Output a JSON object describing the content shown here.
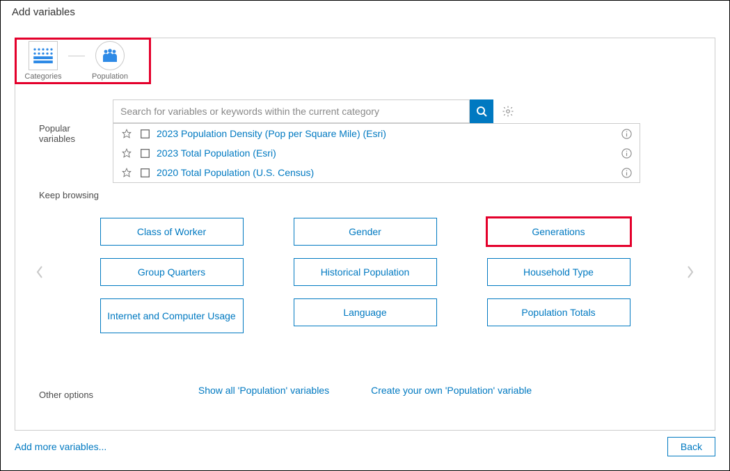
{
  "dialog": {
    "title": "Add variables"
  },
  "breadcrumb": {
    "categories_label": "Categories",
    "population_label": "Population"
  },
  "search": {
    "placeholder": "Search for variables or keywords within the current category"
  },
  "sections": {
    "popular": "Popular variables",
    "keep": "Keep browsing",
    "other": "Other options"
  },
  "popular": [
    {
      "label": "2023 Population Density (Pop per Square Mile) (Esri)"
    },
    {
      "label": "2023 Total Population (Esri)"
    },
    {
      "label": "2020 Total Population (U.S. Census)"
    }
  ],
  "tiles": [
    "Class of Worker",
    "Gender",
    "Generations",
    "Group Quarters",
    "Historical Population",
    "Household Type",
    "Internet and Computer Usage",
    "Language",
    "Population Totals"
  ],
  "options": {
    "show_all": "Show all 'Population' variables",
    "create": "Create your own 'Population' variable"
  },
  "footer": {
    "add_more": "Add more variables...",
    "back": "Back"
  }
}
